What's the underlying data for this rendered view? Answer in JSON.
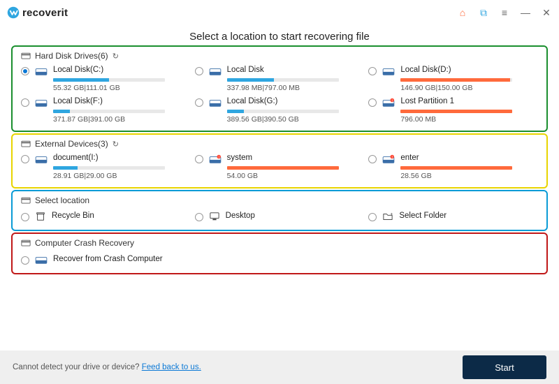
{
  "app": {
    "name": "recoverit"
  },
  "titlebar": {
    "cart": "cart-icon",
    "key": "key-icon",
    "menu": "menu-icon",
    "min": "minimize-icon",
    "close": "close-icon"
  },
  "heading": "Select a location to start recovering file",
  "sections": {
    "hdd": {
      "title": "Hard Disk Drives(6)",
      "items": [
        {
          "name": "Local Disk(C:)",
          "used": "55.32  GB",
          "total": "111.01  GB",
          "sep": "|",
          "fill": 50,
          "color": "blue",
          "warn": false,
          "selected": true
        },
        {
          "name": "Local Disk",
          "used": "337.98  MB",
          "total": "797.00  MB",
          "sep": "|",
          "fill": 42,
          "color": "blue",
          "warn": false,
          "selected": false
        },
        {
          "name": "Local Disk(D:)",
          "used": "146.90  GB",
          "total": "150.00  GB",
          "sep": "|",
          "fill": 98,
          "color": "orange",
          "warn": false,
          "selected": false
        },
        {
          "name": "Local Disk(F:)",
          "used": "371.87  GB",
          "total": "391.00  GB",
          "sep": "|",
          "fill": 15,
          "color": "blue",
          "warn": false,
          "selected": false
        },
        {
          "name": "Local Disk(G:)",
          "used": "389.56  GB",
          "total": "390.50  GB",
          "sep": "|",
          "fill": 15,
          "color": "blue",
          "warn": false,
          "selected": false
        },
        {
          "name": "Lost Partition 1",
          "used": "796.00  MB",
          "total": "",
          "sep": "",
          "fill": 100,
          "color": "orange",
          "warn": true,
          "selected": false
        }
      ]
    },
    "ext": {
      "title": "External Devices(3)",
      "items": [
        {
          "name": "document(I:)",
          "used": "28.91  GB",
          "total": "29.00  GB",
          "sep": "|",
          "fill": 22,
          "color": "blue",
          "warn": false,
          "selected": false
        },
        {
          "name": "system",
          "used": "54.00  GB",
          "total": "",
          "sep": "",
          "fill": 100,
          "color": "orange",
          "warn": true,
          "selected": false
        },
        {
          "name": "enter",
          "used": "28.56  GB",
          "total": "",
          "sep": "",
          "fill": 100,
          "color": "orange",
          "warn": true,
          "selected": false
        }
      ]
    },
    "loc": {
      "title": "Select location",
      "items": [
        {
          "name": "Recycle Bin",
          "icon": "recycle-bin-icon"
        },
        {
          "name": "Desktop",
          "icon": "desktop-icon"
        },
        {
          "name": "Select Folder",
          "icon": "folder-icon"
        }
      ]
    },
    "crash": {
      "title": "Computer Crash Recovery",
      "items": [
        {
          "name": "Recover from Crash Computer"
        }
      ]
    }
  },
  "footer": {
    "text": "Cannot detect your drive or device? ",
    "link": "Feed back to us.",
    "start": "Start"
  }
}
